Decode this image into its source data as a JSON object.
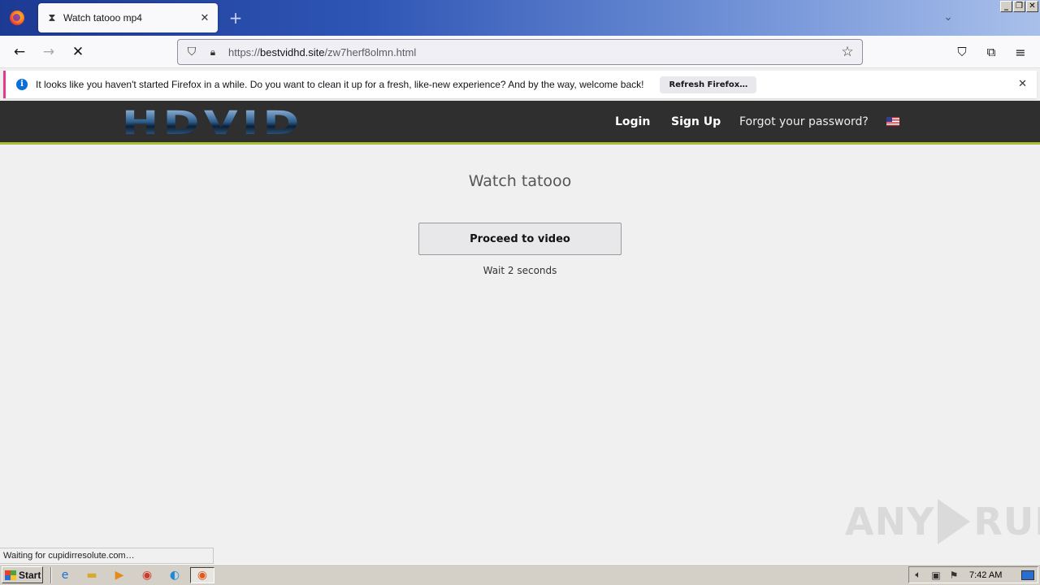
{
  "browser": {
    "tab_title": "Watch tatooo mp4",
    "url_host": "bestvidhd.site",
    "url_scheme": "https://",
    "url_path": "/zw7herf8olmn.html",
    "notification": {
      "message": "It looks like you haven't started Firefox in a while. Do you want to clean it up for a fresh, like-new experience? And by the way, welcome back!",
      "button": "Refresh Firefox…"
    },
    "status_text": "Waiting for cupidirresolute.com…"
  },
  "site": {
    "logo": "HDVID",
    "nav": {
      "login": "Login",
      "signup": "Sign Up",
      "forgot": "Forgot your password?"
    },
    "page_title": "Watch tatooo",
    "proceed_button": "Proceed to video",
    "wait_text": "Wait 2 seconds"
  },
  "watermark": {
    "left": "ANY",
    "right": "RUN"
  },
  "taskbar": {
    "start_label": "Start",
    "clock": "7:42 AM"
  },
  "icons": {
    "firefox": "firefox-icon",
    "hourglass": "hourglass-icon",
    "back": "back-arrow-icon",
    "forward": "forward-arrow-icon",
    "stop": "stop-icon",
    "shield": "shield-icon",
    "lock": "lock-icon",
    "bookmark": "star-icon",
    "pocket": "pocket-icon",
    "extensions": "extensions-icon",
    "menu": "hamburger-menu-icon",
    "flag": "us-flag-icon"
  },
  "colors": {
    "header_bg": "#2f2f2f",
    "header_accent": "#a8c235",
    "notification_accent": "#e33c8c",
    "info_blue": "#0b6fd6"
  }
}
